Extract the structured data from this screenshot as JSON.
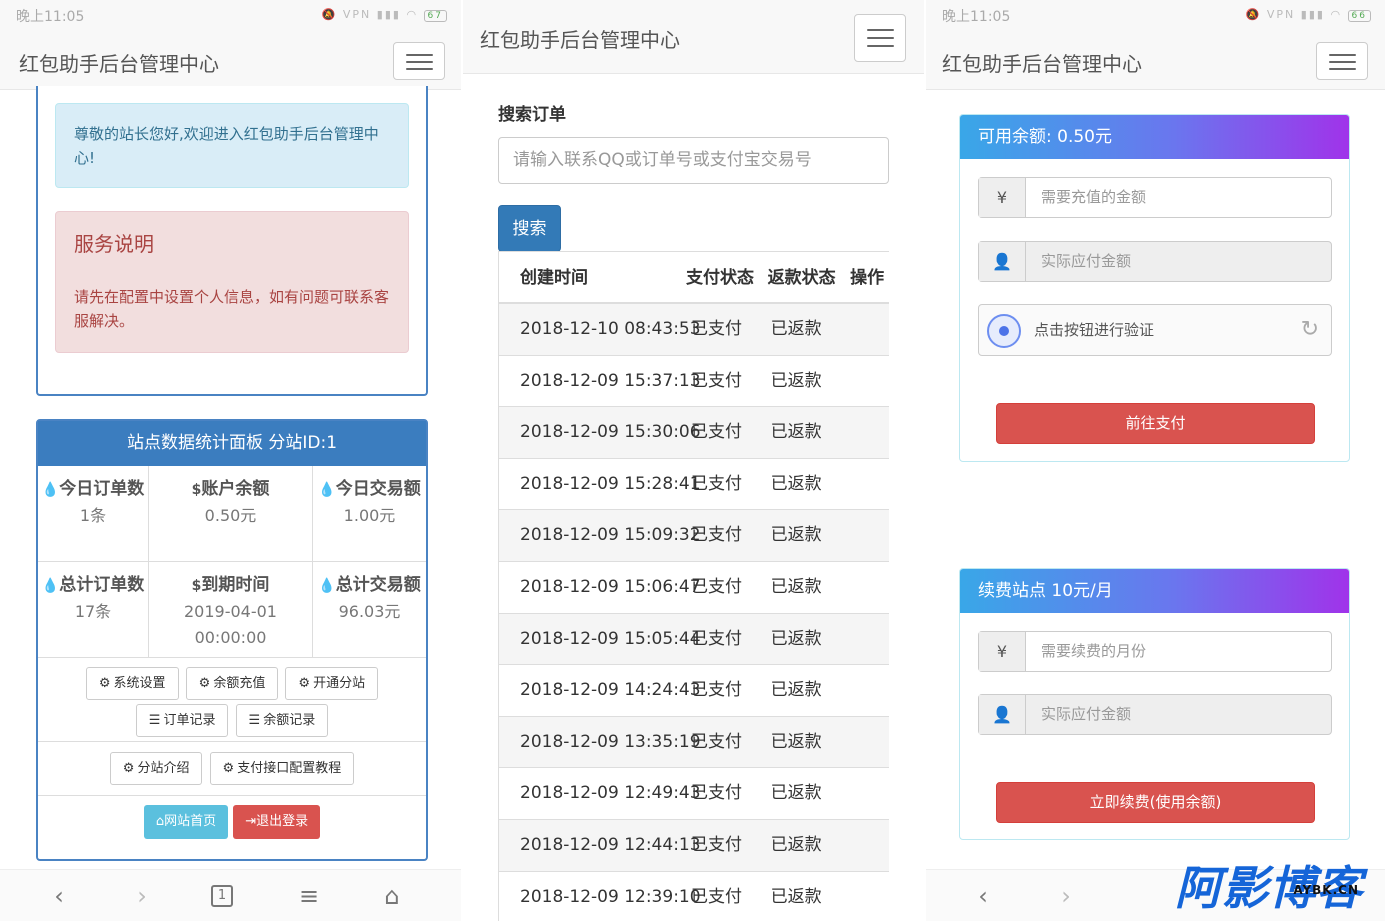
{
  "app_title": "红包助手后台管理中心",
  "status": {
    "time": "晚上11:05",
    "left_batt": "67",
    "right_batt": "66",
    "vpn": "VPN"
  },
  "left": {
    "welcome": "尊敬的站长您好,欢迎进入红包助手后台管理中心!",
    "service_title": "服务说明",
    "service_text": "请先在配置中设置个人信息，如有问题可联系客服解决。",
    "stats_title": "站点数据统计面板 分站ID:1",
    "stats": [
      {
        "icon": "drop-icon",
        "glyph": "💧",
        "label": "今日订单数",
        "value": "1条"
      },
      {
        "icon": "dollar-icon",
        "glyph": "$",
        "label": "账户余额",
        "value": "0.50元"
      },
      {
        "icon": "drop-icon",
        "glyph": "💧",
        "label": "今日交易额",
        "value": "1.00元"
      },
      {
        "icon": "drop-icon",
        "glyph": "💧",
        "label": "总计订单数",
        "value": "17条"
      },
      {
        "icon": "dollar-icon",
        "glyph": "$",
        "label": "到期时间",
        "value": "2019-04-01 00:00:00"
      },
      {
        "icon": "drop-icon",
        "glyph": "💧",
        "label": "总计交易额",
        "value": "96.03元"
      }
    ],
    "buttons": {
      "system_settings": "系统设置",
      "balance_recharge": "余额充值",
      "open_substation": "开通分站",
      "order_records": "订单记录",
      "balance_records": "余额记录",
      "substation_intro": "分站介绍",
      "payment_tutorial": "支付接口配置教程",
      "home": "网站首页",
      "logout": "退出登录"
    },
    "nav_tab_count": "1"
  },
  "mid": {
    "search_title": "搜索订单",
    "search_placeholder": "请输入联系QQ或订单号或支付宝交易号",
    "search_button": "搜索",
    "columns": [
      "创建时间",
      "支付状态",
      "返款状态",
      "操作"
    ],
    "rows": [
      [
        "2018-12-10 08:43:53",
        "已支付",
        "已返款"
      ],
      [
        "2018-12-09 15:37:13",
        "已支付",
        "已返款"
      ],
      [
        "2018-12-09 15:30:06",
        "已支付",
        "已返款"
      ],
      [
        "2018-12-09 15:28:41",
        "已支付",
        "已返款"
      ],
      [
        "2018-12-09 15:09:32",
        "已支付",
        "已返款"
      ],
      [
        "2018-12-09 15:06:47",
        "已支付",
        "已返款"
      ],
      [
        "2018-12-09 15:05:44",
        "已支付",
        "已返款"
      ],
      [
        "2018-12-09 14:24:43",
        "已支付",
        "已返款"
      ],
      [
        "2018-12-09 13:35:19",
        "已支付",
        "已返款"
      ],
      [
        "2018-12-09 12:49:43",
        "已支付",
        "已返款"
      ],
      [
        "2018-12-09 12:44:13",
        "已支付",
        "已返款"
      ],
      [
        "2018-12-09 12:39:10",
        "已支付",
        "已返款"
      ]
    ]
  },
  "right": {
    "balance_title": "可用余额: 0.50元",
    "recharge_placeholder": "需要充值的金额",
    "pay_amount_placeholder": "实际应付金额",
    "captcha_text": "点击按钮进行验证",
    "pay_button": "前往支付",
    "renew_title": "续费站点 10元/月",
    "renew_months_placeholder": "需要续费的月份",
    "renew_amount_placeholder": "实际应付金额",
    "renew_button": "立即续费(使用余额)"
  },
  "watermark": {
    "main": "阿影博客",
    "sub": "AYBK.CN"
  }
}
